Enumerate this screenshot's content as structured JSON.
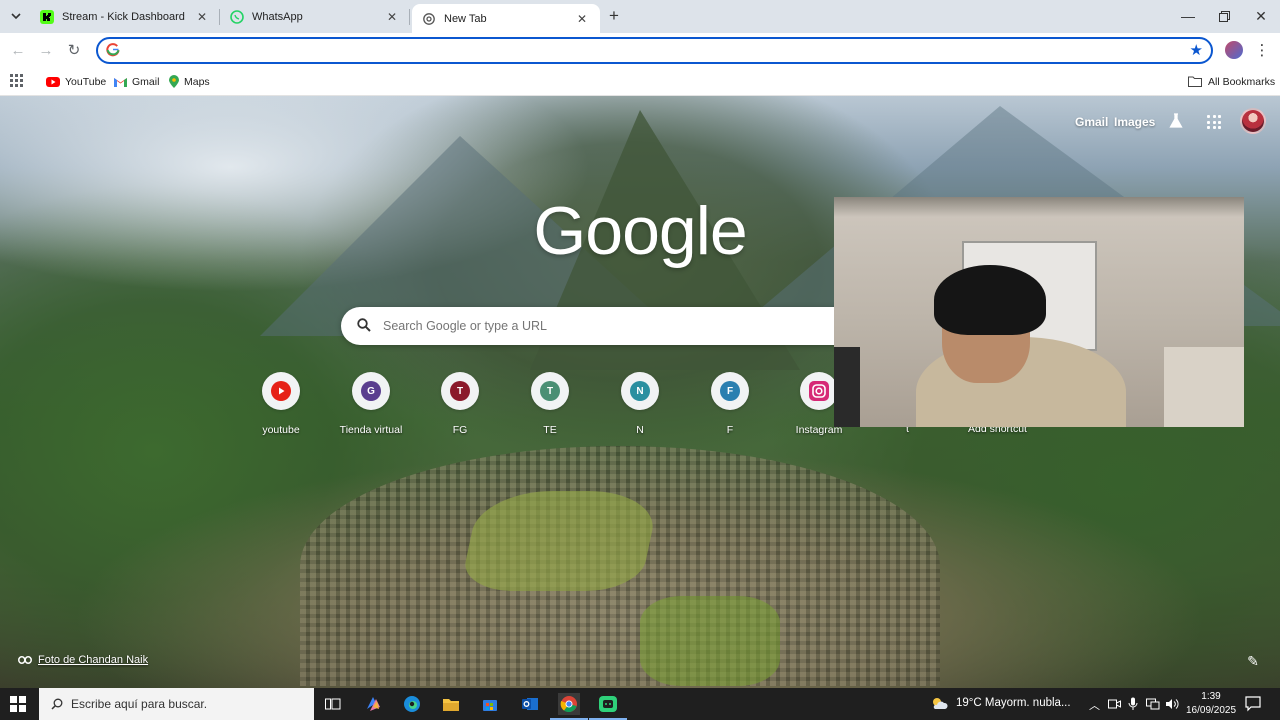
{
  "tabs": [
    {
      "title": "Stream - Kick Dashboard",
      "favicon": "kick-icon"
    },
    {
      "title": "WhatsApp",
      "favicon": "whatsapp-icon"
    },
    {
      "title": "New Tab",
      "favicon": "chrome-icon",
      "active": true
    }
  ],
  "omnibox": {
    "value": ""
  },
  "bookmarks": [
    {
      "label": "YouTube",
      "icon": "youtube-icon"
    },
    {
      "label": "Gmail",
      "icon": "gmail-icon"
    },
    {
      "label": "Maps",
      "icon": "maps-pin-icon"
    }
  ],
  "all_bookmarks_label": "All Bookmarks",
  "ntp": {
    "gmail_link": "Gmail",
    "images_link": "Images",
    "logo": "Google",
    "search_placeholder": "Search Google or type a URL",
    "shortcuts": [
      {
        "label": "youtube",
        "letter": "",
        "color": "#e62117",
        "icon": "youtube-icon"
      },
      {
        "label": "Tienda virtual",
        "letter": "G",
        "color": "#5a3e8f"
      },
      {
        "label": "FG",
        "letter": "T",
        "color": "#8b1a2b"
      },
      {
        "label": "TE",
        "letter": "T",
        "color": "#4a8f74"
      },
      {
        "label": "N",
        "letter": "N",
        "color": "#2a8fa0"
      },
      {
        "label": "F",
        "letter": "F",
        "color": "#2a7fb0"
      },
      {
        "label": "Instagram",
        "letter": "",
        "color": "#d62976",
        "icon": "instagram-icon"
      }
    ],
    "hidden_shortcut_label": "t",
    "add_shortcut_label": "Add shortcut",
    "photo_credit": "Foto de Chandan Naik"
  },
  "taskbar": {
    "search_placeholder": "Escribe aquí para buscar.",
    "weather": "19°C  Mayorm. nubla...",
    "time": "1:39",
    "date": "16/09/2025"
  },
  "colors": {
    "accent": "#0b57d0",
    "tabstrip": "#dde3ea",
    "taskbar": "#1f1f1f"
  }
}
